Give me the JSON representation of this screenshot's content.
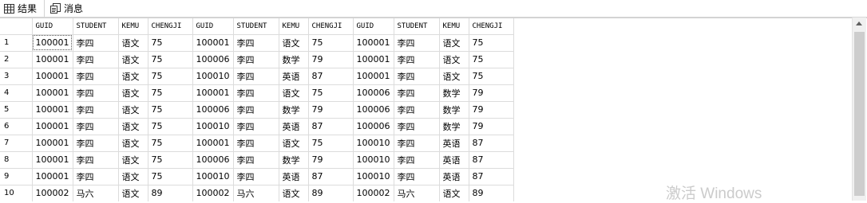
{
  "tabs": {
    "results_label": "结果",
    "messages_label": "消息"
  },
  "grid": {
    "columns": [
      "GUID",
      "STUDENT",
      "KEMU",
      "CHENGJI",
      "GUID",
      "STUDENT",
      "KEMU",
      "CHENGJI",
      "GUID",
      "STUDENT",
      "KEMU",
      "CHENGJI"
    ],
    "rows": [
      [
        "1",
        "100001",
        "李四",
        "语文",
        "75",
        "100001",
        "李四",
        "语文",
        "75",
        "100001",
        "李四",
        "语文",
        "75"
      ],
      [
        "2",
        "100001",
        "李四",
        "语文",
        "75",
        "100006",
        "李四",
        "数学",
        "79",
        "100001",
        "李四",
        "语文",
        "75"
      ],
      [
        "3",
        "100001",
        "李四",
        "语文",
        "75",
        "100010",
        "李四",
        "英语",
        "87",
        "100001",
        "李四",
        "语文",
        "75"
      ],
      [
        "4",
        "100001",
        "李四",
        "语文",
        "75",
        "100001",
        "李四",
        "语文",
        "75",
        "100006",
        "李四",
        "数学",
        "79"
      ],
      [
        "5",
        "100001",
        "李四",
        "语文",
        "75",
        "100006",
        "李四",
        "数学",
        "79",
        "100006",
        "李四",
        "数学",
        "79"
      ],
      [
        "6",
        "100001",
        "李四",
        "语文",
        "75",
        "100010",
        "李四",
        "英语",
        "87",
        "100006",
        "李四",
        "数学",
        "79"
      ],
      [
        "7",
        "100001",
        "李四",
        "语文",
        "75",
        "100001",
        "李四",
        "语文",
        "75",
        "100010",
        "李四",
        "英语",
        "87"
      ],
      [
        "8",
        "100001",
        "李四",
        "语文",
        "75",
        "100006",
        "李四",
        "数学",
        "79",
        "100010",
        "李四",
        "英语",
        "87"
      ],
      [
        "9",
        "100001",
        "李四",
        "语文",
        "75",
        "100010",
        "李四",
        "英语",
        "87",
        "100010",
        "李四",
        "英语",
        "87"
      ],
      [
        "10",
        "100002",
        "马六",
        "语文",
        "89",
        "100002",
        "马六",
        "语文",
        "89",
        "100002",
        "马六",
        "语文",
        "89"
      ]
    ],
    "selected_cell": {
      "row": 0,
      "col": 1
    }
  },
  "watermark": "激活 Windows",
  "icons": {
    "results_tab_icon": "grid-icon",
    "messages_tab_icon": "message-icon"
  }
}
